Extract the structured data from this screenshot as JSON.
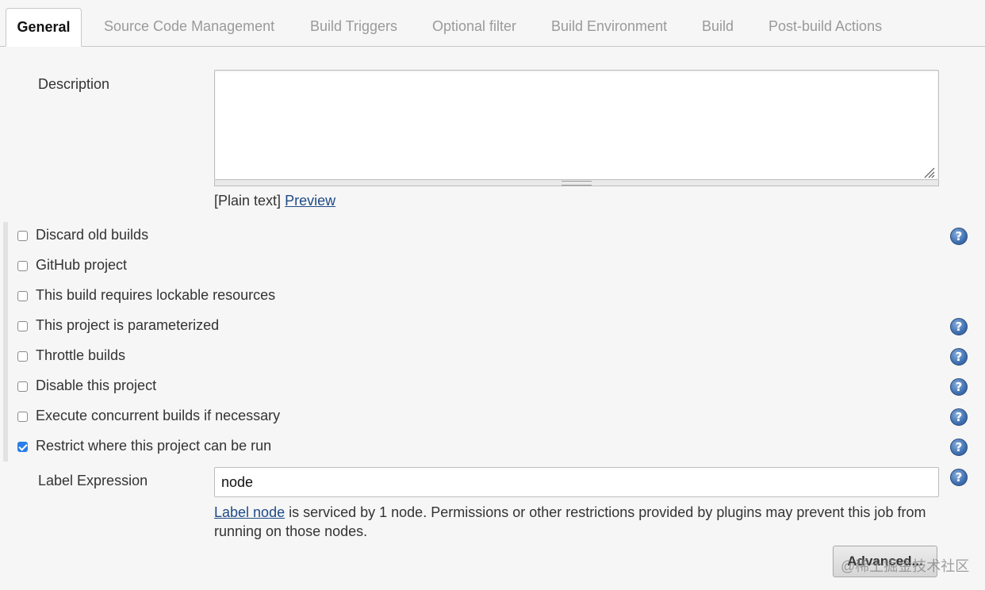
{
  "tabs": [
    {
      "label": "General",
      "active": true
    },
    {
      "label": "Source Code Management",
      "active": false
    },
    {
      "label": "Build Triggers",
      "active": false
    },
    {
      "label": "Optional filter",
      "active": false
    },
    {
      "label": "Build Environment",
      "active": false
    },
    {
      "label": "Build",
      "active": false
    },
    {
      "label": "Post-build Actions",
      "active": false
    }
  ],
  "description": {
    "label": "Description",
    "value": "",
    "format_hint": "[Plain text]",
    "preview_link": "Preview"
  },
  "options": [
    {
      "label": "Discard old builds",
      "checked": false,
      "help": true
    },
    {
      "label": "GitHub project",
      "checked": false,
      "help": false
    },
    {
      "label": "This build requires lockable resources",
      "checked": false,
      "help": false
    },
    {
      "label": "This project is parameterized",
      "checked": false,
      "help": true
    },
    {
      "label": "Throttle builds",
      "checked": false,
      "help": true
    },
    {
      "label": "Disable this project",
      "checked": false,
      "help": true
    },
    {
      "label": "Execute concurrent builds if necessary",
      "checked": false,
      "help": true
    },
    {
      "label": "Restrict where this project can be run",
      "checked": true,
      "help": true
    }
  ],
  "label_expression": {
    "label": "Label Expression",
    "value": "node",
    "info_link": "Label node",
    "info_text": " is serviced by 1 node. Permissions or other restrictions provided by plugins may prevent this job from running on those nodes."
  },
  "advanced_button": "Advanced...",
  "watermark": "@稀土掘金技术社区",
  "help_glyph": "?",
  "colors": {
    "accent": "#2b7de9",
    "link": "#204a87",
    "help_icon": "#3f6fb0"
  }
}
